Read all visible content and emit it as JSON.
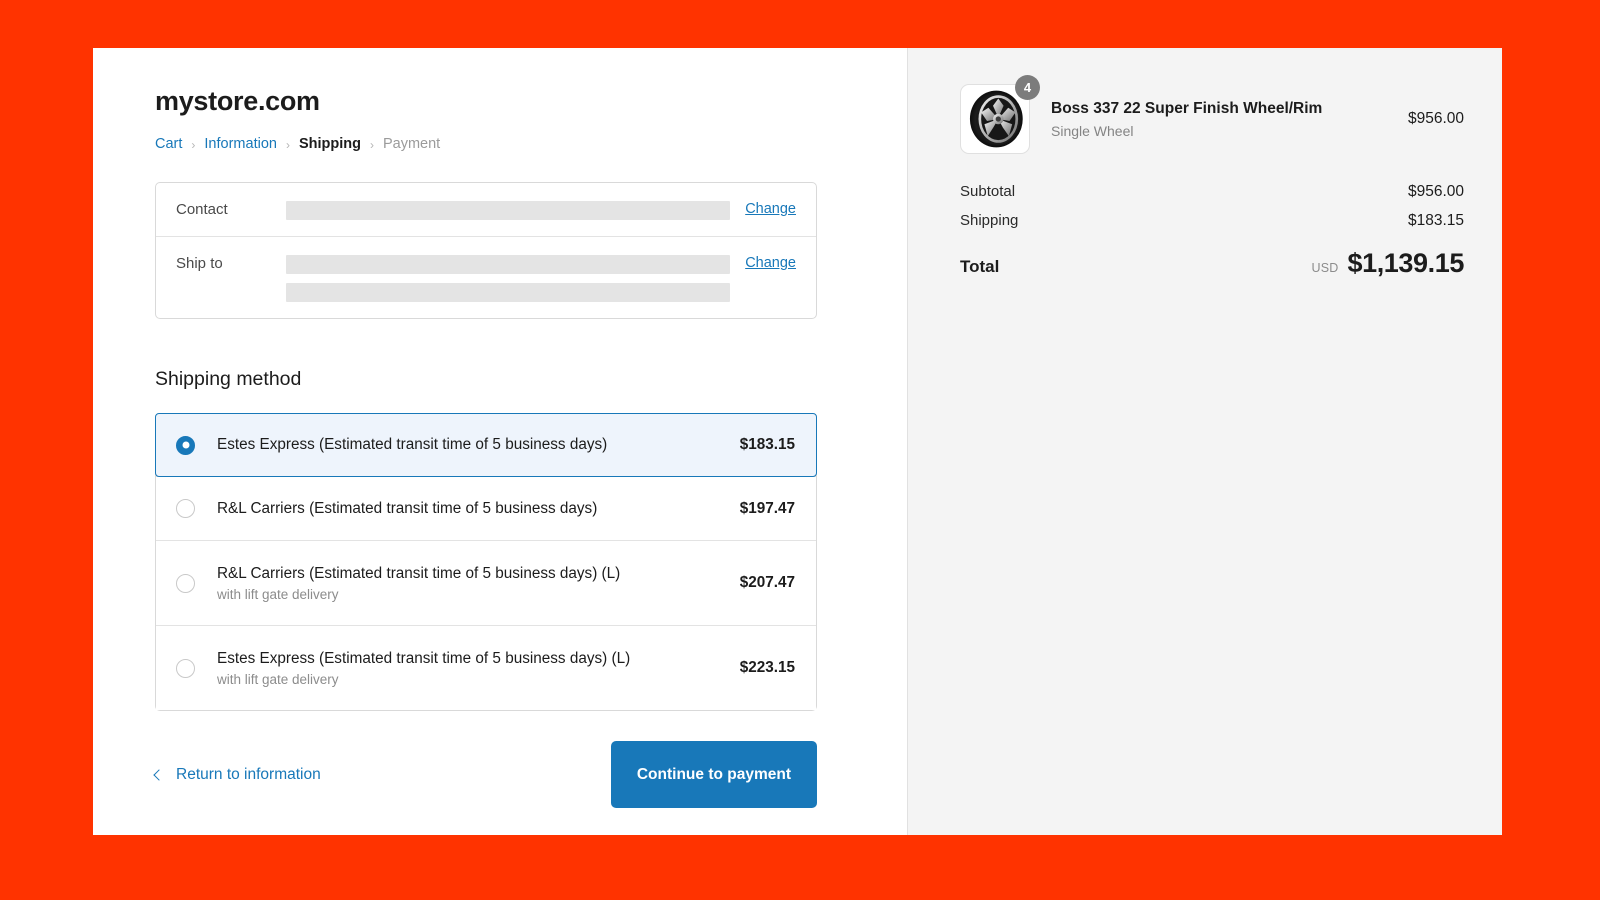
{
  "store": {
    "title": "mystore.com"
  },
  "breadcrumb": {
    "items": [
      {
        "label": "Cart",
        "state": "link"
      },
      {
        "label": "Information",
        "state": "link"
      },
      {
        "label": "Shipping",
        "state": "current"
      },
      {
        "label": "Payment",
        "state": "future"
      }
    ],
    "separator": "›"
  },
  "review": {
    "rows": [
      {
        "label": "Contact",
        "value": "",
        "redacted": true,
        "change_label": "Change"
      },
      {
        "label": "Ship to",
        "value": "",
        "redacted": true,
        "change_label": "Change"
      }
    ]
  },
  "shipping": {
    "section_title": "Shipping method",
    "options": [
      {
        "name": "Estes Express (Estimated transit time of 5 business days)",
        "sub": "",
        "price": "$183.15",
        "selected": true
      },
      {
        "name": "R&L Carriers (Estimated transit time of 5 business days)",
        "sub": "",
        "price": "$197.47",
        "selected": false
      },
      {
        "name": "R&L Carriers (Estimated transit time of 5 business days) (L)",
        "sub": "with lift gate delivery",
        "price": "$207.47",
        "selected": false
      },
      {
        "name": "Estes Express (Estimated transit time of 5 business days) (L)",
        "sub": "with lift gate delivery",
        "price": "$223.15",
        "selected": false
      }
    ]
  },
  "footer": {
    "return_label": "Return to information",
    "continue_label": "Continue to payment"
  },
  "summary": {
    "item": {
      "name": "Boss 337 22 Super Finish Wheel/Rim",
      "variant": "Single Wheel",
      "price": "$956.00",
      "quantity": "4",
      "thumbnail_alt": "alloy-wheel-photo"
    },
    "lines": [
      {
        "label": "Subtotal",
        "value": "$956.00"
      },
      {
        "label": "Shipping",
        "value": "$183.15"
      }
    ],
    "total": {
      "label": "Total",
      "currency": "USD",
      "value": "$1,139.15"
    }
  },
  "colors": {
    "page_background": "#ff3300",
    "accent": "#1878b9",
    "selected_row_background": "#eef4fc",
    "summary_background": "#f4f4f4"
  }
}
